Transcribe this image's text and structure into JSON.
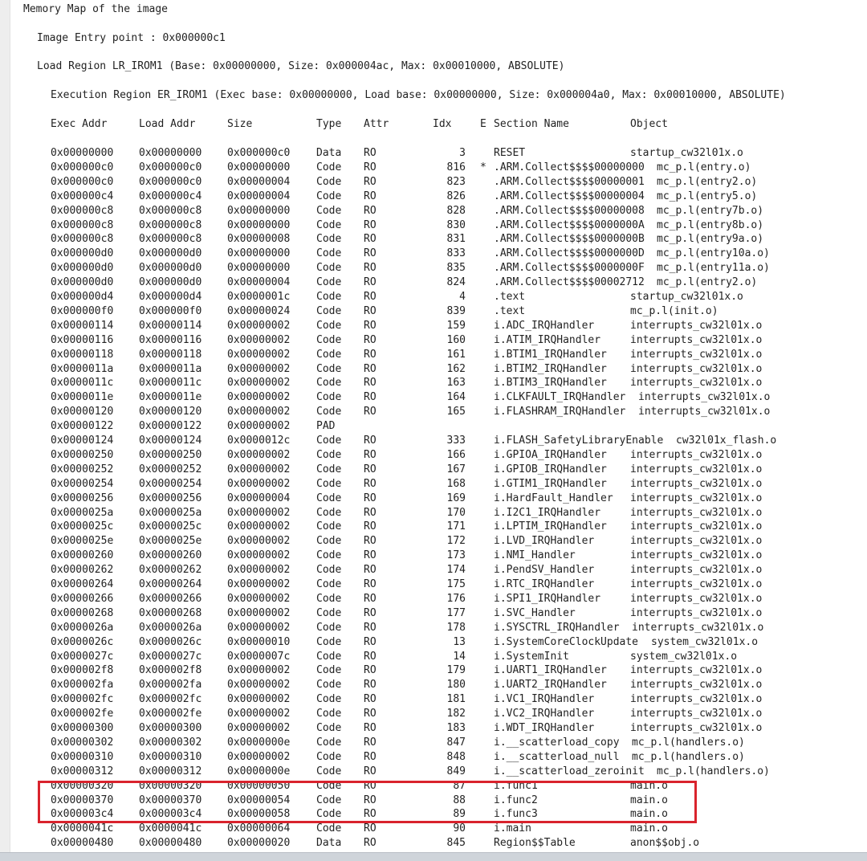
{
  "title": "Memory Map of the image",
  "entry_point": "Image Entry point : 0x000000c1",
  "load_region": "Load Region LR_IROM1 (Base: 0x00000000, Size: 0x000004ac, Max: 0x00010000, ABSOLUTE)",
  "exec_region": "Execution Region ER_IROM1 (Exec base: 0x00000000, Load base: 0x00000000, Size: 0x000004a0, Max: 0x00010000, ABSOLUTE)",
  "headers": {
    "exec_addr": "Exec Addr",
    "load_addr": "Load Addr",
    "size": "Size",
    "type": "Type",
    "attr": "Attr",
    "idx": "Idx",
    "e": "E",
    "section": "Section Name",
    "object": "Object"
  },
  "rows": [
    {
      "exec": "0x00000000",
      "load": "0x00000000",
      "size": "0x000000c0",
      "type": "Data",
      "attr": "RO",
      "idx": "3",
      "e": "",
      "section": "RESET",
      "object": "startup_cw32l01x.o"
    },
    {
      "exec": "0x000000c0",
      "load": "0x000000c0",
      "size": "0x00000000",
      "type": "Code",
      "attr": "RO",
      "idx": "816",
      "e": "*",
      "section": ".ARM.Collect$$$$00000000",
      "object": "mc_p.l(entry.o)"
    },
    {
      "exec": "0x000000c0",
      "load": "0x000000c0",
      "size": "0x00000004",
      "type": "Code",
      "attr": "RO",
      "idx": "823",
      "e": "",
      "section": ".ARM.Collect$$$$00000001",
      "object": "mc_p.l(entry2.o)"
    },
    {
      "exec": "0x000000c4",
      "load": "0x000000c4",
      "size": "0x00000004",
      "type": "Code",
      "attr": "RO",
      "idx": "826",
      "e": "",
      "section": ".ARM.Collect$$$$00000004",
      "object": "mc_p.l(entry5.o)"
    },
    {
      "exec": "0x000000c8",
      "load": "0x000000c8",
      "size": "0x00000000",
      "type": "Code",
      "attr": "RO",
      "idx": "828",
      "e": "",
      "section": ".ARM.Collect$$$$00000008",
      "object": "mc_p.l(entry7b.o)"
    },
    {
      "exec": "0x000000c8",
      "load": "0x000000c8",
      "size": "0x00000000",
      "type": "Code",
      "attr": "RO",
      "idx": "830",
      "e": "",
      "section": ".ARM.Collect$$$$0000000A",
      "object": "mc_p.l(entry8b.o)"
    },
    {
      "exec": "0x000000c8",
      "load": "0x000000c8",
      "size": "0x00000008",
      "type": "Code",
      "attr": "RO",
      "idx": "831",
      "e": "",
      "section": ".ARM.Collect$$$$0000000B",
      "object": "mc_p.l(entry9a.o)"
    },
    {
      "exec": "0x000000d0",
      "load": "0x000000d0",
      "size": "0x00000000",
      "type": "Code",
      "attr": "RO",
      "idx": "833",
      "e": "",
      "section": ".ARM.Collect$$$$0000000D",
      "object": "mc_p.l(entry10a.o)"
    },
    {
      "exec": "0x000000d0",
      "load": "0x000000d0",
      "size": "0x00000000",
      "type": "Code",
      "attr": "RO",
      "idx": "835",
      "e": "",
      "section": ".ARM.Collect$$$$0000000F",
      "object": "mc_p.l(entry11a.o)"
    },
    {
      "exec": "0x000000d0",
      "load": "0x000000d0",
      "size": "0x00000004",
      "type": "Code",
      "attr": "RO",
      "idx": "824",
      "e": "",
      "section": ".ARM.Collect$$$$00002712",
      "object": "mc_p.l(entry2.o)"
    },
    {
      "exec": "0x000000d4",
      "load": "0x000000d4",
      "size": "0x0000001c",
      "type": "Code",
      "attr": "RO",
      "idx": "4",
      "e": "",
      "section": ".text",
      "object": "startup_cw32l01x.o"
    },
    {
      "exec": "0x000000f0",
      "load": "0x000000f0",
      "size": "0x00000024",
      "type": "Code",
      "attr": "RO",
      "idx": "839",
      "e": "",
      "section": ".text",
      "object": "mc_p.l(init.o)"
    },
    {
      "exec": "0x00000114",
      "load": "0x00000114",
      "size": "0x00000002",
      "type": "Code",
      "attr": "RO",
      "idx": "159",
      "e": "",
      "section": "i.ADC_IRQHandler",
      "object": "interrupts_cw32l01x.o"
    },
    {
      "exec": "0x00000116",
      "load": "0x00000116",
      "size": "0x00000002",
      "type": "Code",
      "attr": "RO",
      "idx": "160",
      "e": "",
      "section": "i.ATIM_IRQHandler",
      "object": "interrupts_cw32l01x.o"
    },
    {
      "exec": "0x00000118",
      "load": "0x00000118",
      "size": "0x00000002",
      "type": "Code",
      "attr": "RO",
      "idx": "161",
      "e": "",
      "section": "i.BTIM1_IRQHandler",
      "object": "interrupts_cw32l01x.o"
    },
    {
      "exec": "0x0000011a",
      "load": "0x0000011a",
      "size": "0x00000002",
      "type": "Code",
      "attr": "RO",
      "idx": "162",
      "e": "",
      "section": "i.BTIM2_IRQHandler",
      "object": "interrupts_cw32l01x.o"
    },
    {
      "exec": "0x0000011c",
      "load": "0x0000011c",
      "size": "0x00000002",
      "type": "Code",
      "attr": "RO",
      "idx": "163",
      "e": "",
      "section": "i.BTIM3_IRQHandler",
      "object": "interrupts_cw32l01x.o"
    },
    {
      "exec": "0x0000011e",
      "load": "0x0000011e",
      "size": "0x00000002",
      "type": "Code",
      "attr": "RO",
      "idx": "164",
      "e": "",
      "section": "i.CLKFAULT_IRQHandler",
      "object": "interrupts_cw32l01x.o"
    },
    {
      "exec": "0x00000120",
      "load": "0x00000120",
      "size": "0x00000002",
      "type": "Code",
      "attr": "RO",
      "idx": "165",
      "e": "",
      "section": "i.FLASHRAM_IRQHandler",
      "object": "interrupts_cw32l01x.o"
    },
    {
      "exec": "0x00000122",
      "load": "0x00000122",
      "size": "0x00000002",
      "type": "PAD",
      "attr": "",
      "idx": "",
      "e": "",
      "section": "",
      "object": ""
    },
    {
      "exec": "0x00000124",
      "load": "0x00000124",
      "size": "0x0000012c",
      "type": "Code",
      "attr": "RO",
      "idx": "333",
      "e": "",
      "section": "i.FLASH_SafetyLibraryEnable",
      "object": "cw32l01x_flash.o"
    },
    {
      "exec": "0x00000250",
      "load": "0x00000250",
      "size": "0x00000002",
      "type": "Code",
      "attr": "RO",
      "idx": "166",
      "e": "",
      "section": "i.GPIOA_IRQHandler",
      "object": "interrupts_cw32l01x.o"
    },
    {
      "exec": "0x00000252",
      "load": "0x00000252",
      "size": "0x00000002",
      "type": "Code",
      "attr": "RO",
      "idx": "167",
      "e": "",
      "section": "i.GPIOB_IRQHandler",
      "object": "interrupts_cw32l01x.o"
    },
    {
      "exec": "0x00000254",
      "load": "0x00000254",
      "size": "0x00000002",
      "type": "Code",
      "attr": "RO",
      "idx": "168",
      "e": "",
      "section": "i.GTIM1_IRQHandler",
      "object": "interrupts_cw32l01x.o"
    },
    {
      "exec": "0x00000256",
      "load": "0x00000256",
      "size": "0x00000004",
      "type": "Code",
      "attr": "RO",
      "idx": "169",
      "e": "",
      "section": "i.HardFault_Handler",
      "object": "interrupts_cw32l01x.o"
    },
    {
      "exec": "0x0000025a",
      "load": "0x0000025a",
      "size": "0x00000002",
      "type": "Code",
      "attr": "RO",
      "idx": "170",
      "e": "",
      "section": "i.I2C1_IRQHandler",
      "object": "interrupts_cw32l01x.o"
    },
    {
      "exec": "0x0000025c",
      "load": "0x0000025c",
      "size": "0x00000002",
      "type": "Code",
      "attr": "RO",
      "idx": "171",
      "e": "",
      "section": "i.LPTIM_IRQHandler",
      "object": "interrupts_cw32l01x.o"
    },
    {
      "exec": "0x0000025e",
      "load": "0x0000025e",
      "size": "0x00000002",
      "type": "Code",
      "attr": "RO",
      "idx": "172",
      "e": "",
      "section": "i.LVD_IRQHandler",
      "object": "interrupts_cw32l01x.o"
    },
    {
      "exec": "0x00000260",
      "load": "0x00000260",
      "size": "0x00000002",
      "type": "Code",
      "attr": "RO",
      "idx": "173",
      "e": "",
      "section": "i.NMI_Handler",
      "object": "interrupts_cw32l01x.o"
    },
    {
      "exec": "0x00000262",
      "load": "0x00000262",
      "size": "0x00000002",
      "type": "Code",
      "attr": "RO",
      "idx": "174",
      "e": "",
      "section": "i.PendSV_Handler",
      "object": "interrupts_cw32l01x.o"
    },
    {
      "exec": "0x00000264",
      "load": "0x00000264",
      "size": "0x00000002",
      "type": "Code",
      "attr": "RO",
      "idx": "175",
      "e": "",
      "section": "i.RTC_IRQHandler",
      "object": "interrupts_cw32l01x.o"
    },
    {
      "exec": "0x00000266",
      "load": "0x00000266",
      "size": "0x00000002",
      "type": "Code",
      "attr": "RO",
      "idx": "176",
      "e": "",
      "section": "i.SPI1_IRQHandler",
      "object": "interrupts_cw32l01x.o"
    },
    {
      "exec": "0x00000268",
      "load": "0x00000268",
      "size": "0x00000002",
      "type": "Code",
      "attr": "RO",
      "idx": "177",
      "e": "",
      "section": "i.SVC_Handler",
      "object": "interrupts_cw32l01x.o"
    },
    {
      "exec": "0x0000026a",
      "load": "0x0000026a",
      "size": "0x00000002",
      "type": "Code",
      "attr": "RO",
      "idx": "178",
      "e": "",
      "section": "i.SYSCTRL_IRQHandler",
      "object": "interrupts_cw32l01x.o"
    },
    {
      "exec": "0x0000026c",
      "load": "0x0000026c",
      "size": "0x00000010",
      "type": "Code",
      "attr": "RO",
      "idx": "13",
      "e": "",
      "section": "i.SystemCoreClockUpdate",
      "object": "system_cw32l01x.o"
    },
    {
      "exec": "0x0000027c",
      "load": "0x0000027c",
      "size": "0x0000007c",
      "type": "Code",
      "attr": "RO",
      "idx": "14",
      "e": "",
      "section": "i.SystemInit",
      "object": "system_cw32l01x.o"
    },
    {
      "exec": "0x000002f8",
      "load": "0x000002f8",
      "size": "0x00000002",
      "type": "Code",
      "attr": "RO",
      "idx": "179",
      "e": "",
      "section": "i.UART1_IRQHandler",
      "object": "interrupts_cw32l01x.o"
    },
    {
      "exec": "0x000002fa",
      "load": "0x000002fa",
      "size": "0x00000002",
      "type": "Code",
      "attr": "RO",
      "idx": "180",
      "e": "",
      "section": "i.UART2_IRQHandler",
      "object": "interrupts_cw32l01x.o"
    },
    {
      "exec": "0x000002fc",
      "load": "0x000002fc",
      "size": "0x00000002",
      "type": "Code",
      "attr": "RO",
      "idx": "181",
      "e": "",
      "section": "i.VC1_IRQHandler",
      "object": "interrupts_cw32l01x.o"
    },
    {
      "exec": "0x000002fe",
      "load": "0x000002fe",
      "size": "0x00000002",
      "type": "Code",
      "attr": "RO",
      "idx": "182",
      "e": "",
      "section": "i.VC2_IRQHandler",
      "object": "interrupts_cw32l01x.o"
    },
    {
      "exec": "0x00000300",
      "load": "0x00000300",
      "size": "0x00000002",
      "type": "Code",
      "attr": "RO",
      "idx": "183",
      "e": "",
      "section": "i.WDT_IRQHandler",
      "object": "interrupts_cw32l01x.o"
    },
    {
      "exec": "0x00000302",
      "load": "0x00000302",
      "size": "0x0000000e",
      "type": "Code",
      "attr": "RO",
      "idx": "847",
      "e": "",
      "section": "i.__scatterload_copy",
      "object": "mc_p.l(handlers.o)"
    },
    {
      "exec": "0x00000310",
      "load": "0x00000310",
      "size": "0x00000002",
      "type": "Code",
      "attr": "RO",
      "idx": "848",
      "e": "",
      "section": "i.__scatterload_null",
      "object": "mc_p.l(handlers.o)"
    },
    {
      "exec": "0x00000312",
      "load": "0x00000312",
      "size": "0x0000000e",
      "type": "Code",
      "attr": "RO",
      "idx": "849",
      "e": "",
      "section": "i.__scatterload_zeroinit",
      "object": "mc_p.l(handlers.o)"
    },
    {
      "exec": "0x00000320",
      "load": "0x00000320",
      "size": "0x00000050",
      "type": "Code",
      "attr": "RO",
      "idx": "87",
      "e": "",
      "section": "i.func1",
      "object": "main.o"
    },
    {
      "exec": "0x00000370",
      "load": "0x00000370",
      "size": "0x00000054",
      "type": "Code",
      "attr": "RO",
      "idx": "88",
      "e": "",
      "section": "i.func2",
      "object": "main.o"
    },
    {
      "exec": "0x000003c4",
      "load": "0x000003c4",
      "size": "0x00000058",
      "type": "Code",
      "attr": "RO",
      "idx": "89",
      "e": "",
      "section": "i.func3",
      "object": "main.o"
    },
    {
      "exec": "0x0000041c",
      "load": "0x0000041c",
      "size": "0x00000064",
      "type": "Code",
      "attr": "RO",
      "idx": "90",
      "e": "",
      "section": "i.main",
      "object": "main.o"
    },
    {
      "exec": "0x00000480",
      "load": "0x00000480",
      "size": "0x00000020",
      "type": "Data",
      "attr": "RO",
      "idx": "845",
      "e": "",
      "section": "Region$$Table",
      "object": "anon$$obj.o"
    }
  ],
  "highlight_color": "#d9232d"
}
